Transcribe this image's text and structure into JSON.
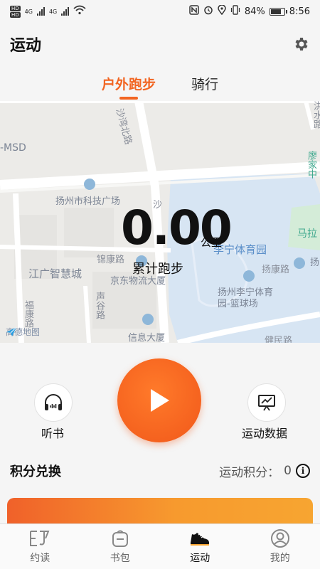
{
  "status_bar": {
    "hd1": "HD",
    "hd2": "HD",
    "net1": "4G",
    "net2": "4G",
    "battery_percent": "84%",
    "battery_level": 0.84,
    "time": "8:56"
  },
  "header": {
    "title": "运动"
  },
  "tabs": [
    {
      "label": "户外跑步",
      "active": true
    },
    {
      "label": "骑行",
      "active": false
    }
  ],
  "map": {
    "labels": {
      "shawan_north_road": "沙湾北路",
      "msd": "-MSD",
      "sci_tech_square": "扬州市科技广场",
      "shawan_short": "沙",
      "jinkang_road": "锦康路",
      "jiangguang_city": "江广智慧城",
      "jd_logistics": "京东物流大厦",
      "lining_stadium": "李宁体育园",
      "lining_court": "扬州李宁体育\n园-篮球场",
      "malai": "马拉",
      "yangkang": "扬康路",
      "yang_short": "扬",
      "fukang_road": "福康路",
      "shenggu_road": "声谷路",
      "xinxi_building": "信息大厦",
      "jianmin_road": "健民路",
      "top_right_1": "洪水路",
      "top_right_2": "廖家中",
      "gaode_logo": "高德地图"
    }
  },
  "distance": {
    "value": "0.00",
    "unit": "公里",
    "label": "累计跑步"
  },
  "controls": {
    "audiobook_label": "听书",
    "stats_label": "运动数据"
  },
  "points": {
    "title": "积分兑换",
    "label": "运动积分：",
    "value": "0"
  },
  "bottom_nav": [
    {
      "label": "约读",
      "icon": "read-icon",
      "active": false
    },
    {
      "label": "书包",
      "icon": "bag-icon",
      "active": false
    },
    {
      "label": "运动",
      "icon": "sneaker-icon",
      "active": true
    },
    {
      "label": "我的",
      "icon": "profile-icon",
      "active": false
    }
  ],
  "colors": {
    "accent": "#f26522",
    "play_button": "#f1581a",
    "map_water": "#d7e5f3",
    "map_bg": "#ecebe8"
  }
}
